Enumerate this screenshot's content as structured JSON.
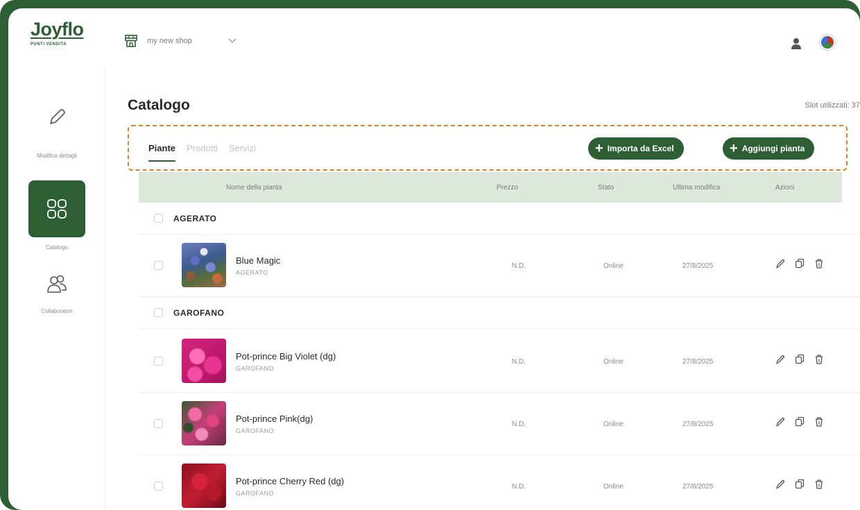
{
  "brand": {
    "name": "Joyflo",
    "subtitle": "PUNTI VENDITA"
  },
  "shop": {
    "name": "my new shop"
  },
  "sidebar": {
    "items": [
      {
        "label": "Modifica dettagli",
        "icon": "pencil-icon",
        "active": false
      },
      {
        "label": "Catalogo",
        "icon": "grid-icon",
        "active": true
      },
      {
        "label": "Collaboratori",
        "icon": "users-icon",
        "active": false
      }
    ]
  },
  "page": {
    "title": "Catalogo",
    "slots": "Slot utilizzati: 37"
  },
  "tabs": [
    {
      "label": "Piante",
      "active": true
    },
    {
      "label": "Prodotti",
      "active": false
    },
    {
      "label": "Servizi",
      "active": false
    }
  ],
  "buttons": {
    "import": "Importa da Excel",
    "add": "Aggiungi pianta"
  },
  "table": {
    "headers": {
      "name": "Nome della pianta",
      "price": "Prezzo",
      "status": "Stato",
      "modified": "Ultima modifica",
      "actions": "Azioni"
    },
    "groups": [
      {
        "name": "AGERATO",
        "items": [
          {
            "name": "Blue Magic",
            "category": "AGERATO",
            "price": "N.D.",
            "status": "Online",
            "modified": "27/8/2025"
          }
        ]
      },
      {
        "name": "GAROFANO",
        "items": [
          {
            "name": "Pot-prince Big Violet (dg)",
            "category": "GAROFANO",
            "price": "N.D.",
            "status": "Online",
            "modified": "27/8/2025"
          },
          {
            "name": "Pot-prince Pink(dg)",
            "category": "GAROFANO",
            "price": "N.D.",
            "status": "Online",
            "modified": "27/8/2025"
          },
          {
            "name": "Pot-prince Cherry Red (dg)",
            "category": "GAROFANO",
            "price": "N.D.",
            "status": "Online",
            "modified": "27/8/2025"
          }
        ]
      }
    ]
  },
  "colors": {
    "brand_green": "#2e5e34",
    "header_green": "#dce9db",
    "highlight_orange": "#d9822b"
  }
}
